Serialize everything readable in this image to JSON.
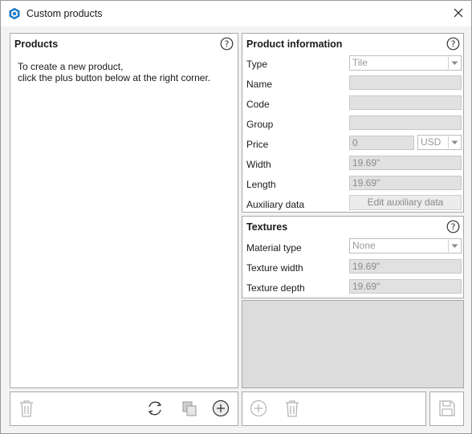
{
  "window": {
    "title": "Custom products"
  },
  "products": {
    "title": "Products",
    "message_line1": "To create a new product,",
    "message_line2": "click the plus button below at the right corner."
  },
  "product_info": {
    "title": "Product information",
    "type_label": "Type",
    "type_value": "Tile",
    "name_label": "Name",
    "name_value": "",
    "code_label": "Code",
    "code_value": "",
    "group_label": "Group",
    "group_value": "",
    "price_label": "Price",
    "price_value": "0",
    "currency_value": "USD",
    "width_label": "Width",
    "width_value": "19.69\"",
    "length_label": "Length",
    "length_value": "19.69\"",
    "aux_label": "Auxiliary data",
    "aux_button": "Edit auxiliary data"
  },
  "textures": {
    "title": "Textures",
    "material_label": "Material type",
    "material_value": "None",
    "tex_width_label": "Texture width",
    "tex_width_value": "19.69\"",
    "tex_depth_label": "Texture depth",
    "tex_depth_value": "19.69\""
  },
  "colors": {
    "accent": "#1e7ac8",
    "disabled": "#b5b5b5",
    "field_bg": "#e1e1e1"
  }
}
